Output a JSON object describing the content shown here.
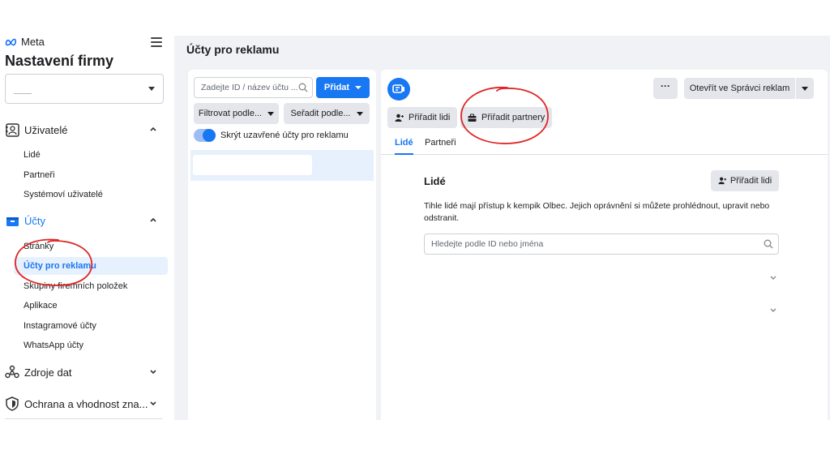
{
  "sidebar": {
    "logo_text": "Meta",
    "title": "Nastavení firmy",
    "sections": {
      "users": {
        "label": "Uživatelé",
        "items": [
          "Lidé",
          "Partneři",
          "Systémoví uživatelé"
        ]
      },
      "accounts": {
        "label": "Účty",
        "items": [
          "Stránky",
          "Účty pro reklamu",
          "Skupiny firemních položek",
          "Aplikace",
          "Instagramové účty",
          "WhatsApp účty"
        ]
      },
      "data_sources": {
        "label": "Zdroje dat"
      },
      "brand_safety": {
        "label": "Ochrana a vhodnost zna..."
      }
    },
    "selected_item": "Účty pro reklamu"
  },
  "main": {
    "page_title": "Účty pro reklamu",
    "list": {
      "search_placeholder": "Zadejte ID / název účtu ...",
      "add_label": "Přidat",
      "filter_label": "Filtrovat podle...",
      "sort_label": "Seřadit podle...",
      "toggle_label": "Skrýt uzavřené účty pro reklamu",
      "toggle_on": true
    },
    "detail": {
      "more_label": "···",
      "open_label": "Otevřít ve Správci reklam",
      "assign_people_label": "Přiřadit lidi",
      "assign_partners_label": "Přiřadit partnery",
      "tabs": [
        "Lidé",
        "Partneři"
      ],
      "active_tab": "Lidé",
      "people_title": "Lidé",
      "people_assign_label": "Přiřadit lidi",
      "people_desc": "Tihle lidé mají přístup k kempik Olbec. Jejich oprávnění si můžete prohlédnout, upravit nebo odstranit.",
      "people_search_placeholder": "Hledejte podle ID nebo jména"
    }
  },
  "colors": {
    "accent": "#1877f2",
    "annotation": "#e02424",
    "background": "#f0f2f5",
    "selected_bg": "#e7f0fd"
  }
}
